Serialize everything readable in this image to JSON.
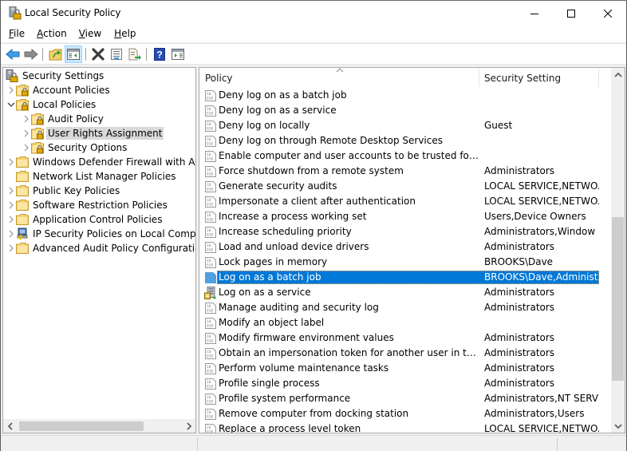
{
  "window": {
    "title": "Local Security Policy",
    "controls": [
      "minimize",
      "maximize",
      "close"
    ]
  },
  "menu": [
    {
      "label": "File",
      "accel": "F",
      "rest": "ile"
    },
    {
      "label": "Action",
      "accel": "A",
      "rest": "ction"
    },
    {
      "label": "View",
      "accel": "V",
      "rest": "iew"
    },
    {
      "label": "Help",
      "accel": "H",
      "rest": "elp"
    }
  ],
  "toolbar": {
    "buttons": [
      {
        "name": "back",
        "icon": "back-arrow-icon"
      },
      {
        "name": "forward",
        "icon": "forward-arrow-icon"
      },
      {
        "name": "up-one-level",
        "icon": "folder-up-icon"
      },
      {
        "name": "show-hide-console-tree",
        "icon": "console-tree-icon",
        "active": true
      },
      {
        "name": "delete",
        "icon": "delete-x-icon"
      },
      {
        "name": "properties",
        "icon": "properties-icon"
      },
      {
        "name": "export-list",
        "icon": "export-list-icon"
      },
      {
        "name": "help",
        "icon": "help-icon"
      },
      {
        "name": "show-hide-action-pane",
        "icon": "action-pane-icon"
      }
    ]
  },
  "tree": {
    "root": {
      "label": "Security Settings",
      "icon": "security-settings-icon"
    },
    "items": [
      {
        "label": "Account Policies",
        "level": 1,
        "expander": "collapsed",
        "icon": "locked-folder-icon"
      },
      {
        "label": "Local Policies",
        "level": 1,
        "expander": "expanded",
        "icon": "locked-folder-icon"
      },
      {
        "label": "Audit Policy",
        "level": 2,
        "expander": "collapsed",
        "icon": "locked-folder-icon"
      },
      {
        "label": "User Rights Assignment",
        "level": 2,
        "expander": "collapsed",
        "icon": "locked-folder-icon",
        "selected": true
      },
      {
        "label": "Security Options",
        "level": 2,
        "expander": "collapsed",
        "icon": "locked-folder-icon"
      },
      {
        "label": "Windows Defender Firewall with Adva",
        "level": 1,
        "expander": "collapsed",
        "icon": "folder-icon"
      },
      {
        "label": "Network List Manager Policies",
        "level": 1,
        "expander": "none",
        "icon": "folder-icon"
      },
      {
        "label": "Public Key Policies",
        "level": 1,
        "expander": "collapsed",
        "icon": "folder-icon"
      },
      {
        "label": "Software Restriction Policies",
        "level": 1,
        "expander": "collapsed",
        "icon": "folder-icon"
      },
      {
        "label": "Application Control Policies",
        "level": 1,
        "expander": "collapsed",
        "icon": "folder-icon"
      },
      {
        "label": "IP Security Policies on Local Compute",
        "level": 1,
        "expander": "collapsed",
        "icon": "ip-security-icon"
      },
      {
        "label": "Advanced Audit Policy Configuration",
        "level": 1,
        "expander": "collapsed",
        "icon": "folder-icon"
      }
    ]
  },
  "list": {
    "columns": [
      {
        "label": "Policy",
        "sorted": "ascending"
      },
      {
        "label": "Security Setting"
      }
    ],
    "rows": [
      {
        "policy": "Deny log on as a batch job",
        "setting": ""
      },
      {
        "policy": "Deny log on as a service",
        "setting": ""
      },
      {
        "policy": "Deny log on locally",
        "setting": "Guest"
      },
      {
        "policy": "Deny log on through Remote Desktop Services",
        "setting": ""
      },
      {
        "policy": "Enable computer and user accounts to be trusted for delega...",
        "setting": ""
      },
      {
        "policy": "Force shutdown from a remote system",
        "setting": "Administrators"
      },
      {
        "policy": "Generate security audits",
        "setting": "LOCAL SERVICE,NETWO..."
      },
      {
        "policy": "Impersonate a client after authentication",
        "setting": "LOCAL SERVICE,NETWO..."
      },
      {
        "policy": "Increase a process working set",
        "setting": "Users,Device Owners"
      },
      {
        "policy": "Increase scheduling priority",
        "setting": "Administrators,Window ..."
      },
      {
        "policy": "Load and unload device drivers",
        "setting": "Administrators"
      },
      {
        "policy": "Lock pages in memory",
        "setting": "BROOKS\\Dave"
      },
      {
        "policy": "Log on as a batch job",
        "setting": "BROOKS\\Dave,Administ...",
        "selected": true
      },
      {
        "policy": "Log on as a service",
        "setting": "Administrators",
        "icon": "server-policy-icon"
      },
      {
        "policy": "Manage auditing and security log",
        "setting": "Administrators"
      },
      {
        "policy": "Modify an object label",
        "setting": ""
      },
      {
        "policy": "Modify firmware environment values",
        "setting": "Administrators"
      },
      {
        "policy": "Obtain an impersonation token for another user in the same...",
        "setting": "Administrators"
      },
      {
        "policy": "Perform volume maintenance tasks",
        "setting": "Administrators"
      },
      {
        "policy": "Profile single process",
        "setting": "Administrators"
      },
      {
        "policy": "Profile system performance",
        "setting": "Administrators,NT SERVI..."
      },
      {
        "policy": "Remove computer from docking station",
        "setting": "Administrators,Users"
      },
      {
        "policy": "Replace a process level token",
        "setting": "LOCAL SERVICE,NETWO..."
      }
    ]
  },
  "scrollbars": {
    "list_vertical_position": 0.55,
    "tree_horizontal_position": 0.0
  },
  "colors": {
    "selection": "#0078d7",
    "tree_selection": "#d9d9d9",
    "toolbar_active": "#cce8ff"
  }
}
